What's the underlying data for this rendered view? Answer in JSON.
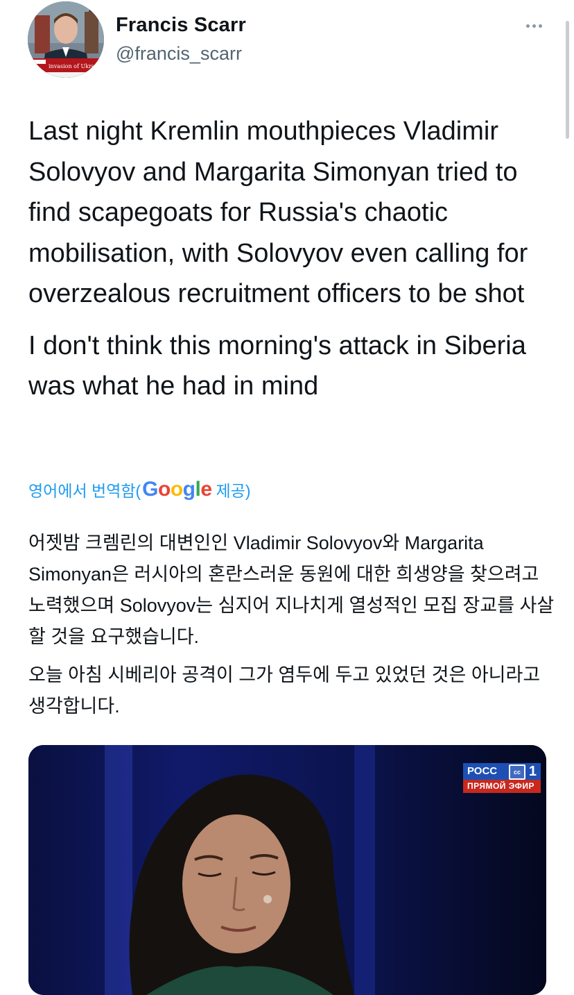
{
  "author": {
    "name": "Francis Scarr",
    "handle": "@francis_scarr"
  },
  "avatar": {
    "overlay_line": "invasion of Ukraine"
  },
  "tweet": {
    "paragraph_1": "Last night Kremlin mouthpieces Vladimir Solovyov and Margarita Simonyan tried to find scapegoats for Russia's chaotic mobilisation, with Solovyov even calling for overzealous recruitment officers to be shot",
    "paragraph_2": "I don't think this morning's attack in Siberia was what he had in mind"
  },
  "translation": {
    "prefix": "영어에서 번역함(",
    "provider": "Google",
    "suffix": " 제공)",
    "paragraph_1": "어젯밤 크렘린의 대변인인 Vladimir Solovyov와 Margarita Simonyan은 러시아의 혼란스러운 동원에 대한 희생양을 찾으려고 노력했으며 Solovyov는 심지어 지나치게 열성적인 모집 장교를 사살할 것을 요구했습니다.",
    "paragraph_2": "오늘 아침 시베리아 공격이 그가 염두에 두고 있었던 것은 아니라고 생각합니다."
  },
  "media": {
    "channel_name": "РОСС",
    "channel_number": "1",
    "cc_label": "cc",
    "live_label": "ПРЯМОЙ ЭФИР"
  },
  "colors": {
    "accent": "#1d9bf0",
    "secondary_text": "#536471",
    "primary_text": "#0f1419"
  },
  "icons": {
    "more": "more-horizontal-icon"
  }
}
